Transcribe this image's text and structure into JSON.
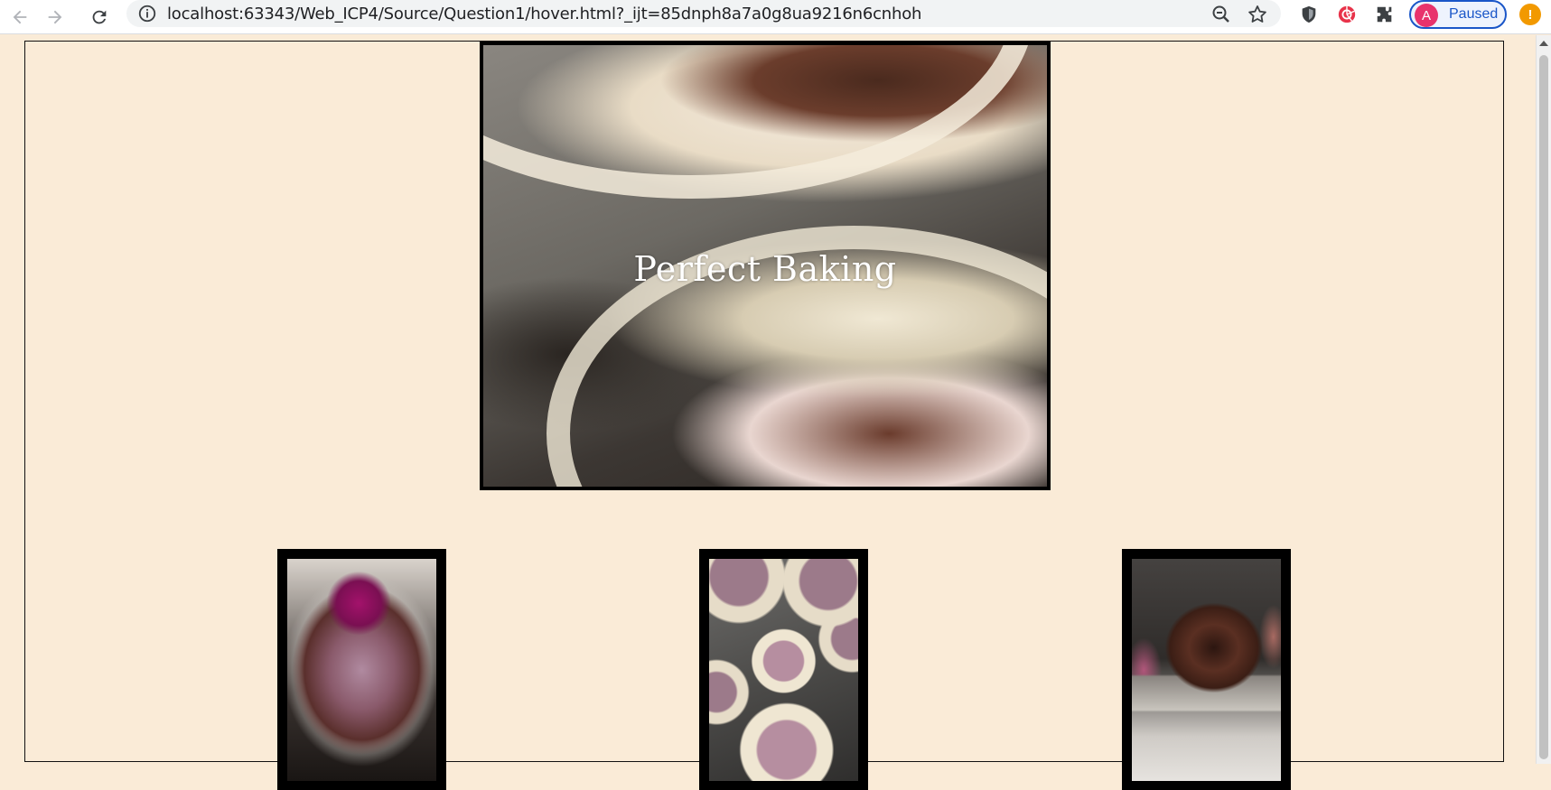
{
  "browser": {
    "url": "localhost:63343/Web_ICP4/Source/Question1/hover.html?_ijt=85dnph8a7a0g8ua9216n6cnhoh",
    "profile_initial": "A",
    "profile_status": "Paused",
    "update_badge": "!",
    "icons": {
      "back": "back-arrow-icon",
      "forward": "forward-arrow-icon",
      "reload": "reload-icon",
      "site_info": "info-icon",
      "zoom": "zoom-out-icon",
      "bookmark": "star-icon",
      "ext1": "shield-extension-icon",
      "ext2": "red-extension-icon",
      "extensions": "puzzle-icon"
    }
  },
  "page": {
    "background_color": "#faebd7",
    "hero": {
      "title": "Perfect Baking",
      "image": "cupcake-liners-closeup"
    },
    "thumbnails": [
      {
        "image": "chocolate-batter-bowl"
      },
      {
        "image": "cupcake-tin-batter"
      },
      {
        "image": "chocolate-frosted-cupcake"
      }
    ]
  }
}
